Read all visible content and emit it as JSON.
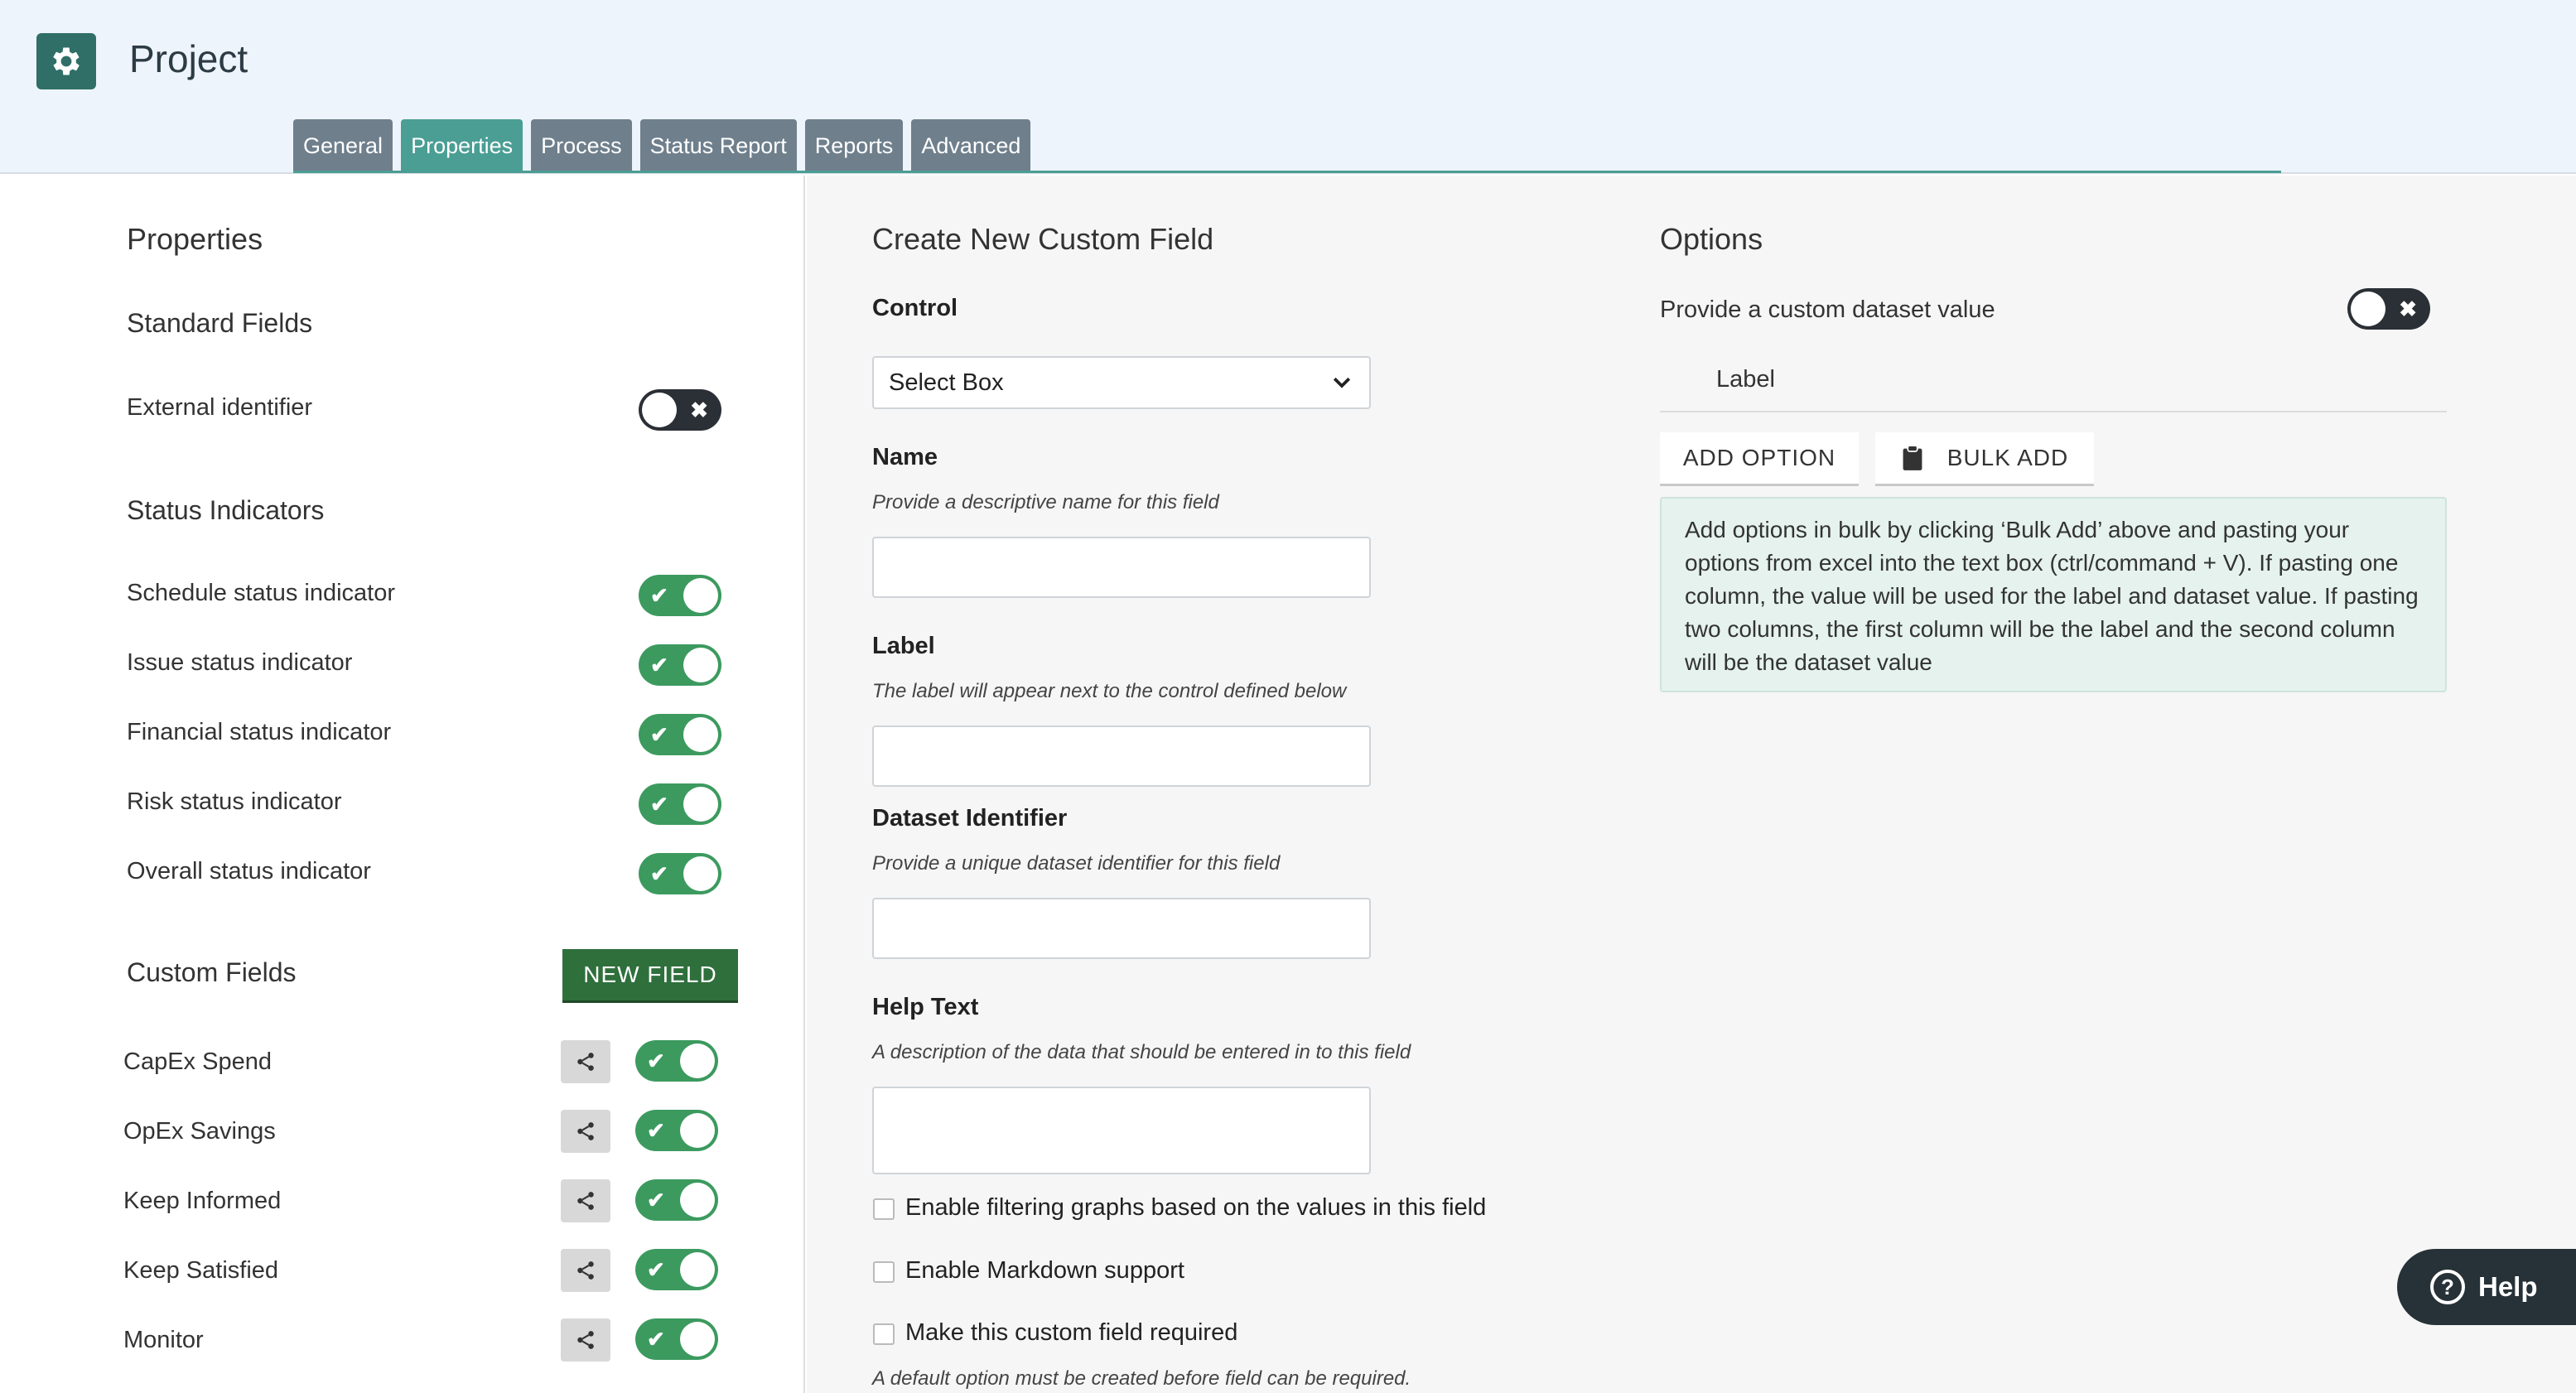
{
  "header": {
    "title": "Project",
    "tabs": [
      {
        "label": "General"
      },
      {
        "label": "Properties"
      },
      {
        "label": "Process"
      },
      {
        "label": "Status Report"
      },
      {
        "label": "Reports"
      },
      {
        "label": "Advanced"
      }
    ],
    "active_tab": "Properties"
  },
  "properties": {
    "title": "Properties",
    "standard_fields_heading": "Standard Fields",
    "external_identifier": {
      "label": "External identifier",
      "enabled": false
    },
    "status_indicators_heading": "Status Indicators",
    "status_indicators": [
      {
        "label": "Schedule status indicator",
        "enabled": true
      },
      {
        "label": "Issue status indicator",
        "enabled": true
      },
      {
        "label": "Financial status indicator",
        "enabled": true
      },
      {
        "label": "Risk status indicator",
        "enabled": true
      },
      {
        "label": "Overall status indicator",
        "enabled": true
      }
    ],
    "custom_fields_heading": "Custom Fields",
    "new_field_label": "NEW FIELD",
    "custom_fields": [
      {
        "label": "CapEx Spend",
        "enabled": true
      },
      {
        "label": "OpEx Savings",
        "enabled": true
      },
      {
        "label": "Keep Informed",
        "enabled": true
      },
      {
        "label": "Keep Satisfied",
        "enabled": true
      },
      {
        "label": "Monitor",
        "enabled": true
      }
    ]
  },
  "create_field": {
    "title": "Create New Custom Field",
    "control_label": "Control",
    "control_value": "Select Box",
    "name_label": "Name",
    "name_help": "Provide a descriptive name for this field",
    "label_label": "Label",
    "label_help": "The label will appear next to the control defined below",
    "dataset_label": "Dataset Identifier",
    "dataset_help": "Provide a unique dataset identifier for this field",
    "help_text_label": "Help Text",
    "help_text_help": "A description of the data that should be entered in to this field",
    "checkboxes": [
      {
        "label": "Enable filtering graphs based on the values in this field",
        "checked": false
      },
      {
        "label": "Enable Markdown support",
        "checked": false
      },
      {
        "label": "Make this custom field required",
        "checked": false
      }
    ],
    "required_note": "A default option must be created before field can be required."
  },
  "options": {
    "title": "Options",
    "custom_dataset_label": "Provide a custom dataset value",
    "custom_dataset_enabled": false,
    "label_column": "Label",
    "add_option_label": "ADD OPTION",
    "bulk_add_label": "BULK ADD",
    "info_text": "Add options in bulk by clicking ‘Bulk Add’ above and pasting your options from excel into the text box (ctrl/command + V). If pasting one column, the value will be used for the label and dataset value. If pasting two columns, the first column will be the label and the second column will be the dataset value"
  },
  "help_button": {
    "label": "Help"
  },
  "colors": {
    "accent": "#4a9e94",
    "tab": "#6f7f8c",
    "toggle_on": "#3c9a5f",
    "toggle_off": "#2b3036",
    "new_field": "#2f6f3c"
  }
}
